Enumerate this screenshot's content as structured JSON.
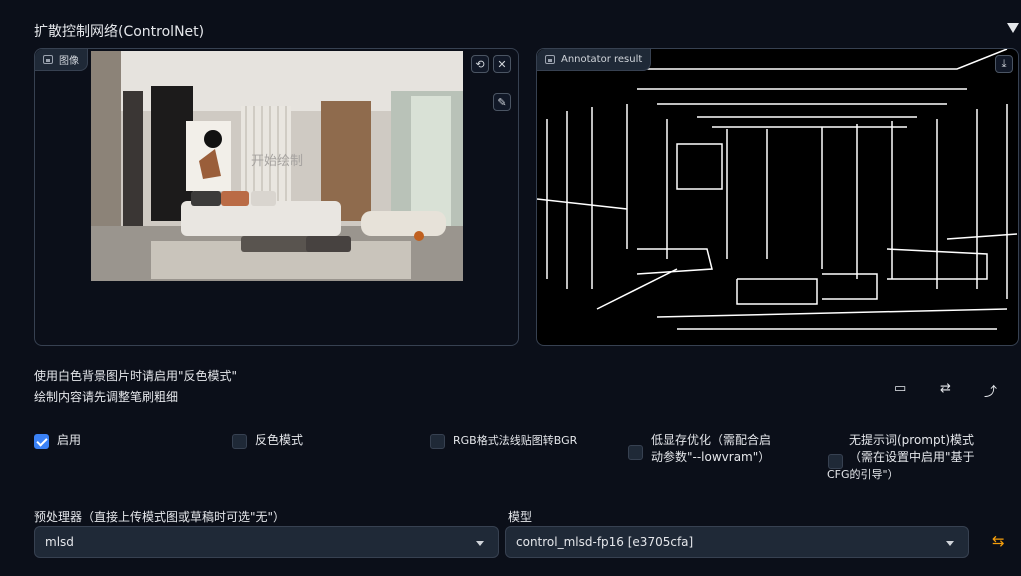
{
  "accordion": {
    "title": "扩散控制网络(ControlNet)",
    "collapse_icon": "triangle-down-icon"
  },
  "image_input": {
    "label": "图像",
    "watermark": "开始绘制",
    "tools": {
      "undo": "⟲",
      "close": "✕",
      "brush": "✎"
    }
  },
  "annotator": {
    "label": "Annotator result",
    "download_glyph": "⤓"
  },
  "hints": {
    "line1": "使用白色背景图片时请启用\"反色模式\"",
    "line2": "绘制内容请先调整笔刷粗细"
  },
  "tool_icons": {
    "camera": "▭",
    "swap": "⇄",
    "send": "⤴"
  },
  "options": {
    "enable": {
      "label": "启用",
      "checked": true
    },
    "invert": {
      "label": "反色模式",
      "checked": false
    },
    "rgb_bgr": {
      "label": "RGB格式法线贴图转BGR",
      "checked": false
    },
    "lowvram": {
      "label_1": "低显存优化（需配合启",
      "label_2": "动参数\"--lowvram\"）",
      "checked": false
    },
    "guess": {
      "label_1": "无提示词(prompt)模式",
      "label_2": "（需在设置中启用\"基于",
      "label_3": "CFG的引导\"）",
      "checked": false
    }
  },
  "preprocessor": {
    "label": "预处理器（直接上传模式图或草稿时可选\"无\"）",
    "value": "mlsd"
  },
  "model": {
    "label": "模型",
    "value": "control_mlsd-fp16 [e3705cfa]",
    "refresh_glyph": "⇆"
  },
  "colors": {
    "accent": "#3b82f6",
    "background": "#0b0f19",
    "field": "#1f2937",
    "border": "#374151"
  }
}
